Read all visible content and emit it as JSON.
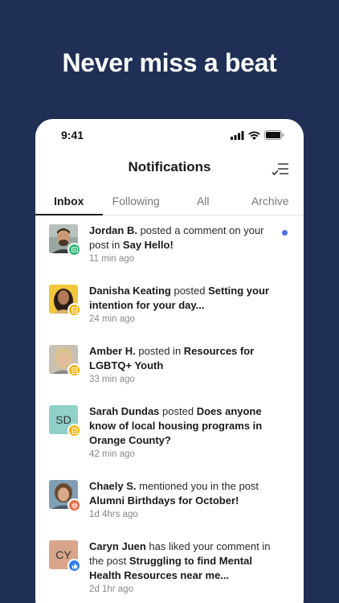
{
  "headline": "Never miss a beat",
  "status_bar": {
    "time": "9:41"
  },
  "header": {
    "title": "Notifications"
  },
  "tabs": [
    {
      "label": "Inbox",
      "active": true
    },
    {
      "label": "Following",
      "active": false
    },
    {
      "label": "All",
      "active": false
    },
    {
      "label": "Archive",
      "active": false
    }
  ],
  "notifications": [
    {
      "name": "Jordan B.",
      "action": " posted a comment on your post in ",
      "target": "Say Hello!",
      "time": "11 min ago",
      "unread": true,
      "badge": "comment-icon",
      "badge_color": "#2bb673",
      "avatar": "photo"
    },
    {
      "name": "Danisha Keating",
      "action": " posted ",
      "target": "Setting your intention for your day...",
      "time": "24 min ago",
      "unread": false,
      "badge": "post-icon",
      "badge_color": "#f5b400",
      "avatar": "photo"
    },
    {
      "name": "Amber H.",
      "action": " posted in ",
      "target": "Resources for LGBTQ+ Youth",
      "time": "33 min ago",
      "unread": false,
      "badge": "post-icon",
      "badge_color": "#f5b400",
      "avatar": "photo"
    },
    {
      "name": "Sarah Dundas",
      "action": " posted ",
      "target": "Does anyone know of local housing programs in Orange County?",
      "time": "42 min ago",
      "unread": false,
      "badge": "post-icon",
      "badge_color": "#f5b400",
      "avatar": "initials",
      "initials": "SD",
      "avatar_color": "#8fd1c8"
    },
    {
      "name": "Chaely S.",
      "action": " mentioned you in the post ",
      "target": "Alumni Birthdays for October!",
      "time": "1d 4hrs ago",
      "unread": false,
      "badge": "mention-icon",
      "badge_color": "#ef6b4a",
      "avatar": "photo"
    },
    {
      "name": "Caryn Juen",
      "action": " has liked your comment in the post ",
      "target": "Struggling to find Mental Health Resources near me...",
      "time": "2d 1hr ago",
      "unread": false,
      "badge": "like-icon",
      "badge_color": "#2f80ed",
      "avatar": "initials",
      "initials": "CY",
      "avatar_color": "#d8a58c"
    }
  ],
  "colors": {
    "background": "#1f2f55",
    "unread_dot": "#4f6fe0"
  }
}
